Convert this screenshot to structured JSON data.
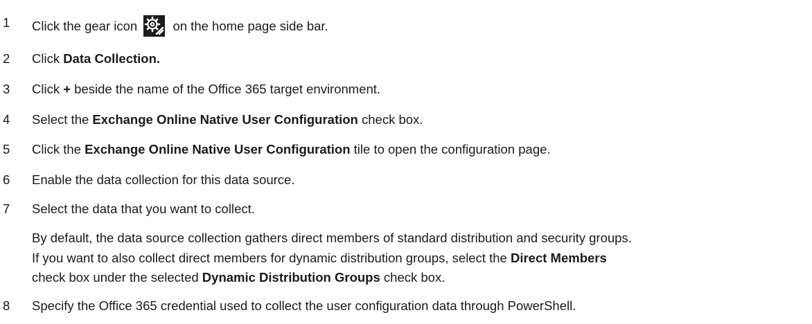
{
  "steps": [
    {
      "num": "1",
      "before": "Click the gear icon",
      "after": "on the home page side bar.",
      "icon": "gear-icon"
    },
    {
      "num": "2",
      "before": "Click ",
      "bold": "Data Collection."
    },
    {
      "num": "3",
      "before": "Click ",
      "bold": "+",
      "after": " beside the name of the Office 365 target environment."
    },
    {
      "num": "4",
      "before": "Select the ",
      "bold": "Exchange Online Native User Configuration",
      "after": " check box."
    },
    {
      "num": "5",
      "before": "Click the ",
      "bold": "Exchange Online Native User Configuration",
      "after": " tile to open the configuration page."
    },
    {
      "num": "6",
      "before": "Enable the data collection for this data source."
    },
    {
      "num": "7",
      "before": "Select the data that you want to collect."
    },
    {
      "num": "8",
      "before": "Specify the Office 365 credential used to collect the user configuration data through PowerShell."
    }
  ],
  "note": {
    "line1": "By default, the data source collection gathers direct members of standard distribution and security groups.",
    "line2_before": "If you want to also collect direct members for dynamic distribution groups, select the ",
    "line2_bold": "Direct Members",
    "line3_before": "check box under the selected ",
    "line3_bold": "Dynamic Distribution Groups",
    "line3_after": " check box."
  },
  "colors": {
    "text": "#1a1a1a",
    "icon_bg": "#1c1c1c"
  }
}
